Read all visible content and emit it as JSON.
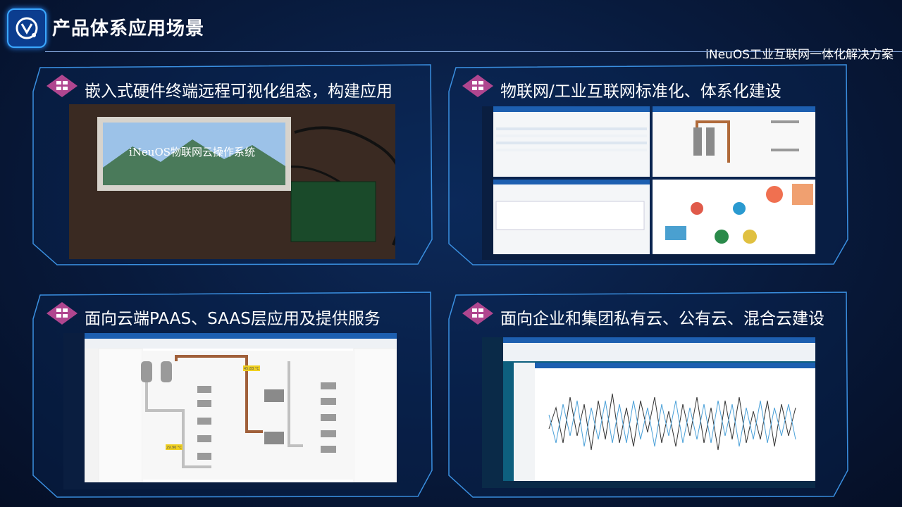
{
  "header": {
    "title": "产品体系应用场景",
    "subtitle": "iNeuOS工业互联网一体化解决方案"
  },
  "panels": [
    {
      "heading": "嵌入式硬件终端远程可视化组态，构建应用",
      "screen_text": "iNeuOS物联网云操作系统"
    },
    {
      "heading": "物联网/工业互联网标准化、体系化建设"
    },
    {
      "heading": "面向云端PAAS、SAAS层应用及提供服务",
      "readouts": [
        "45.83 °C",
        "29.96 °C"
      ]
    },
    {
      "heading": "面向企业和集团私有云、公有云、混合云建设"
    }
  ],
  "colors": {
    "accent": "#3aa7ff",
    "frame": "#3a8fe0",
    "badge": "#b0468f"
  }
}
